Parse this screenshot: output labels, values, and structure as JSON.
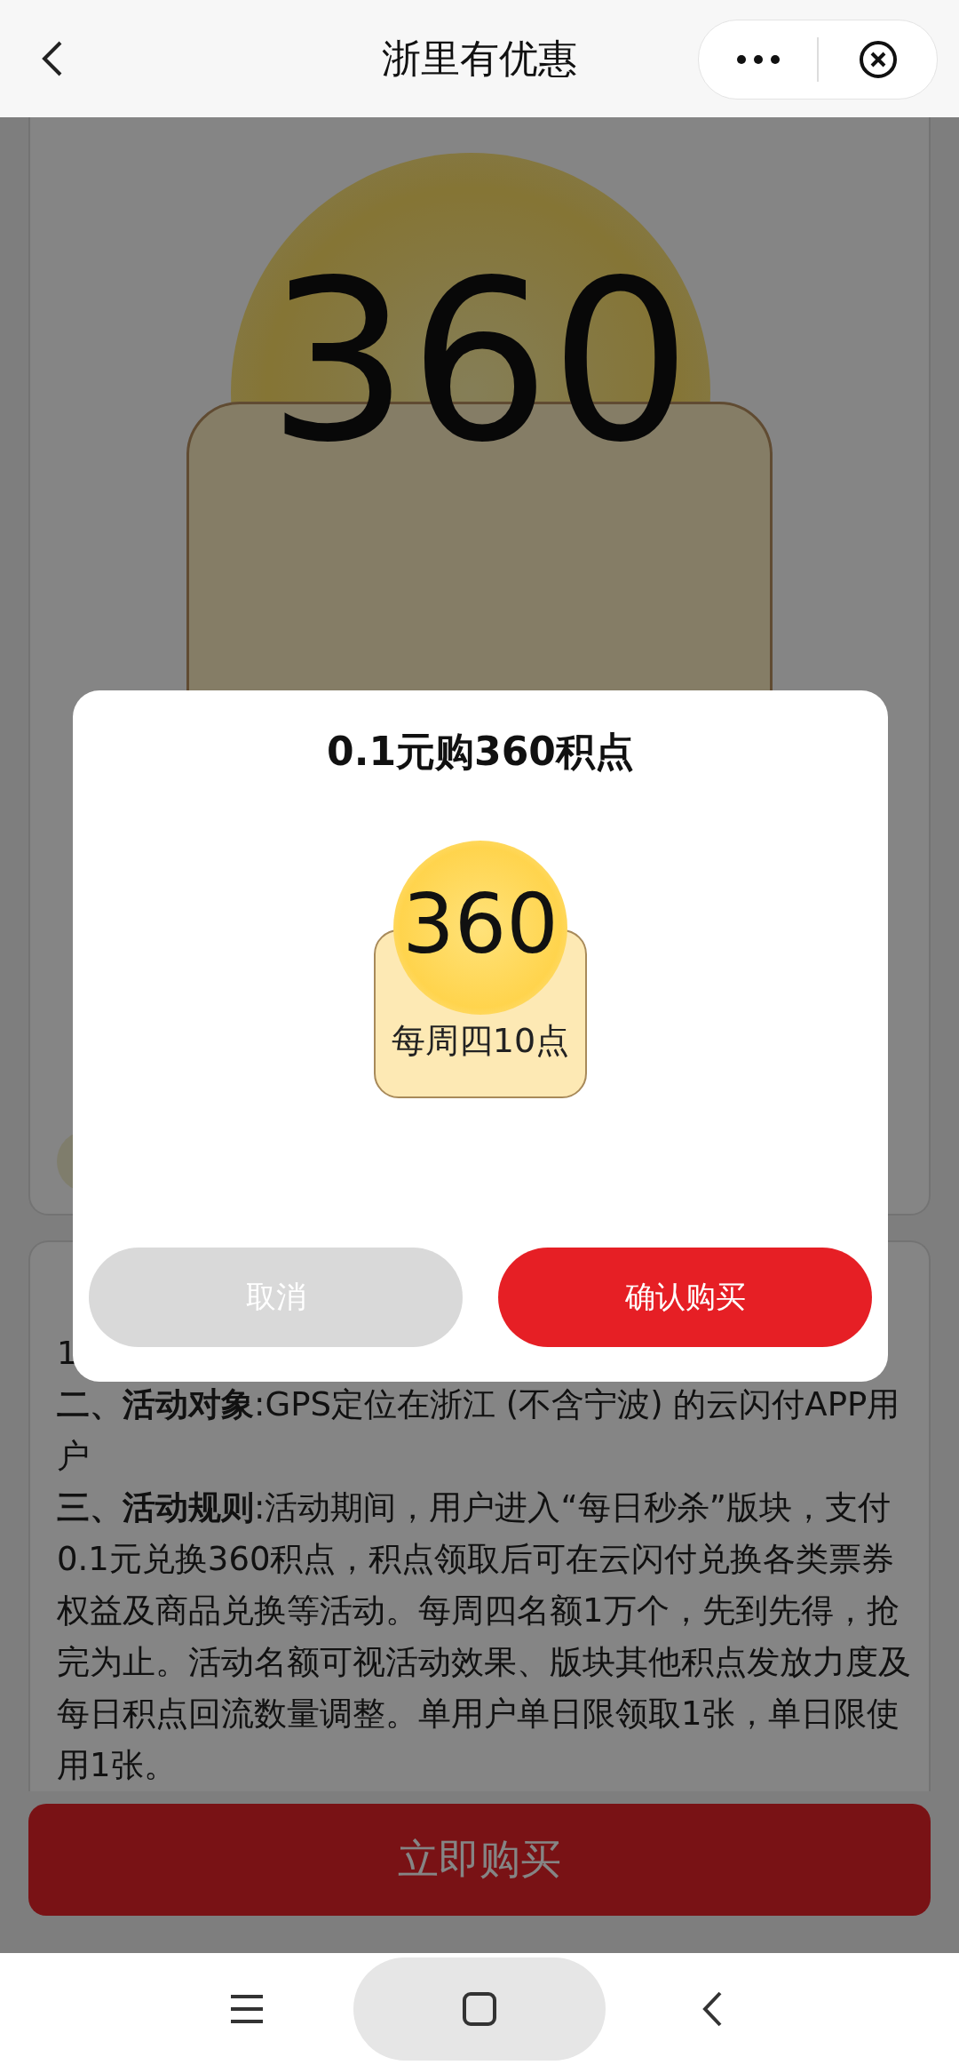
{
  "header": {
    "title": "浙里有优惠"
  },
  "product": {
    "hero_number": "360"
  },
  "rules": {
    "partial_lines": [
      "1"
    ],
    "paragraphs": [
      "**二、活动对象**:GPS定位在浙江 (不含宁波) 的云闪付APP用户",
      "**三、活动规则**:活动期间，用户进入“每日秒杀”版块，支付0.1元兑换360积点，积点领取后可在云闪付兑换各类票券权益及商品兑换等活动。每周四名额1万个，先到先得，抢完为止。活动名额可视活动效果、版块其他积点发放力度及每日积点回流数量调整。单用户单日限领取1张，单日限使用1张。"
    ]
  },
  "buy_button": {
    "label": "立即购买"
  },
  "dialog": {
    "title": "0.1元购360积点",
    "coupon": {
      "number": "360",
      "schedule": "每周四10点"
    },
    "buttons": [
      {
        "label": "取消",
        "kind": "cancel"
      },
      {
        "label": "确认购买",
        "kind": "confirm"
      }
    ]
  }
}
